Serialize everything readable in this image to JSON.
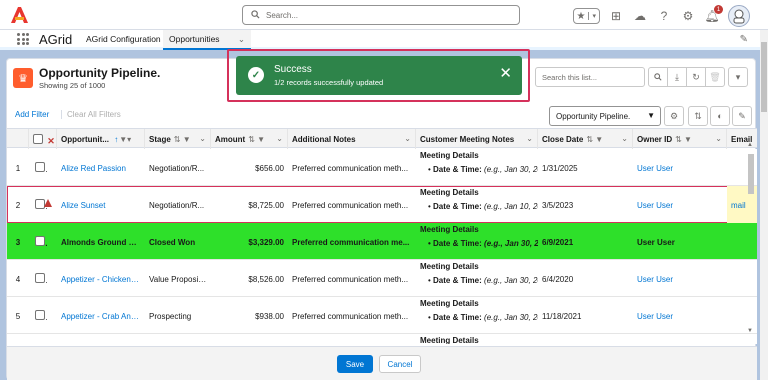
{
  "header": {
    "search_placeholder": "Search...",
    "notification_count": "1",
    "icons": [
      "star-icon",
      "add-icon",
      "trailhead-icon",
      "help-icon",
      "gear-icon",
      "bell-icon",
      "avatar"
    ]
  },
  "nav": {
    "app_name": "AGrid",
    "tabs": [
      {
        "label": "AGrid Configuration"
      },
      {
        "label": "Opportunities"
      }
    ]
  },
  "list": {
    "title": "Opportunity Pipeline.",
    "subtitle": "Showing 25 of 1000",
    "search_placeholder": "Search this list...",
    "add_filter": "Add Filter",
    "clear_filters": "All Filters",
    "clear_prefix": "Clear",
    "view_name": "Opportunity Pipeline."
  },
  "columns": [
    {
      "label": "Opportunit...",
      "sort": "↑ ▼▾"
    },
    {
      "label": "Stage",
      "sort": "⇅ ▼"
    },
    {
      "label": "Amount",
      "sort": "⇅ ▼"
    },
    {
      "label": "Additional Notes",
      "sort": ""
    },
    {
      "label": "Customer Meeting Notes",
      "sort": ""
    },
    {
      "label": "Close Date",
      "sort": "⇅ ▼"
    },
    {
      "label": "Owner ID",
      "sort": "⇅ ▼"
    },
    {
      "label": "Email",
      "sort": ""
    }
  ],
  "rows": [
    {
      "num": "1",
      "name": "Alize Red Passion",
      "stage": "Negotiation/R...",
      "amount": "$656.00",
      "notes": "Preferred communication meth...",
      "meet_head": "Meeting Details",
      "meet_label": "Date & Time:",
      "meet_val": "(e.g., Jan 30, 20",
      "close": "1/31/2025",
      "owner": "User User",
      "email": ""
    },
    {
      "num": "2",
      "name": "Alize Sunset",
      "stage": "Negotiation/R...",
      "amount": "$8,725.00",
      "notes": "Preferred communication meth...",
      "meet_head": "Meeting Details",
      "meet_label": "Date & Time:",
      "meet_val": "(e.g., Jan 10, 20",
      "close": "3/5/2023",
      "owner": "User User",
      "email": "mail"
    },
    {
      "num": "3",
      "name": "Almonds Ground Bl...",
      "stage": "Closed Won",
      "amount": "$3,329.00",
      "notes": "Preferred communication me...",
      "meet_head": "Meeting Details",
      "meet_label": "Date & Time:",
      "meet_val": "(e.g., Jan 30, 2",
      "close": "6/9/2021",
      "owner": "User User",
      "email": ""
    },
    {
      "num": "4",
      "name": "Appetizer - Chicken S...",
      "stage": "Value Proposit...",
      "amount": "$8,526.00",
      "notes": "Preferred communication meth...",
      "meet_head": "Meeting Details",
      "meet_label": "Date & Time:",
      "meet_val": "(e.g., Jan 30, 20",
      "close": "6/4/2020",
      "owner": "User User",
      "email": ""
    },
    {
      "num": "5",
      "name": "Appetizer - Crab And...",
      "stage": "Prospecting",
      "amount": "$938.00",
      "notes": "Preferred communication meth...",
      "meet_head": "Meeting Details",
      "meet_label": "Date & Time:",
      "meet_val": "(e.g., Jan 30, 20",
      "close": "11/18/2021",
      "owner": "User User",
      "email": ""
    },
    {
      "num": "",
      "name": "",
      "stage": "",
      "amount": "",
      "notes": "",
      "meet_head": "Meeting Details",
      "meet_label": "",
      "meet_val": "",
      "close": "",
      "owner": "",
      "email": ""
    }
  ],
  "toast": {
    "title": "Success",
    "message": "1/2 records successfully updated"
  },
  "footer": {
    "save": "Save",
    "cancel": "Cancel"
  },
  "colors": {
    "accent": "#0176d3",
    "success": "#2e844a",
    "highlight_row": "#2ee02a",
    "error": "#d5315b"
  }
}
